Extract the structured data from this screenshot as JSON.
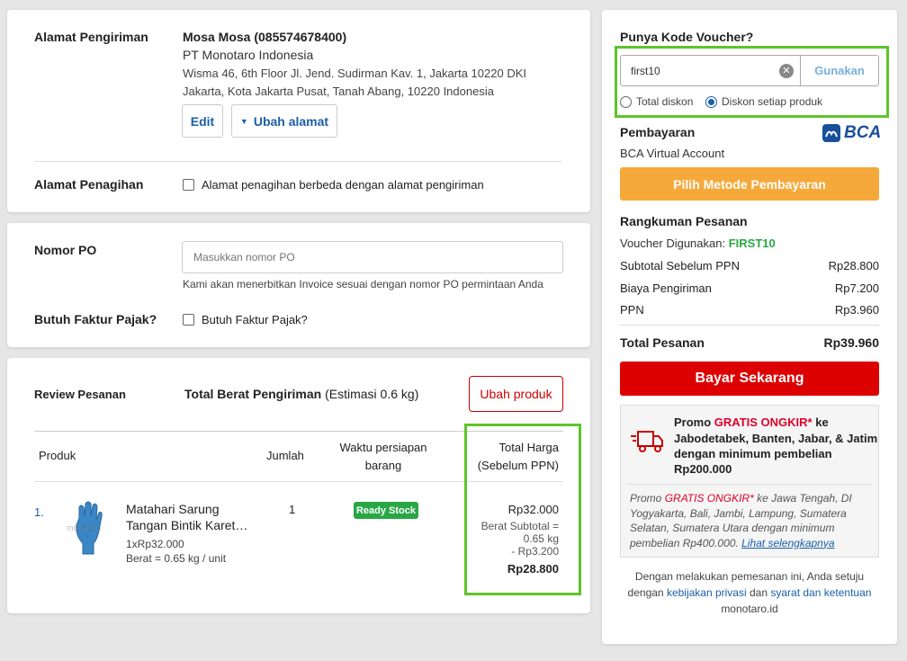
{
  "shipping": {
    "label": "Alamat Pengiriman",
    "name": "Mosa Mosa (085574678400)",
    "company": "PT Monotaro Indonesia",
    "address_line1": "Wisma 46, 6th Floor Jl. Jend. Sudirman Kav. 1, Jakarta 10220 DKI",
    "address_line2": "Jakarta, Kota Jakarta Pusat, Tanah Abang, 10220 Indonesia",
    "edit_label": "Edit",
    "change_label": "Ubah alamat"
  },
  "billing": {
    "label": "Alamat Penagihan",
    "checkbox_label": "Alamat penagihan berbeda dengan alamat pengiriman"
  },
  "po": {
    "label": "Nomor PO",
    "placeholder": "Masukkan nomor PO",
    "hint": "Kami akan menerbitkan Invoice sesuai dengan nomor PO permintaan Anda",
    "tax_label": "Butuh Faktur Pajak?",
    "tax_checkbox_label": "Butuh Faktur Pajak?"
  },
  "review": {
    "label": "Review Pesanan",
    "weight_label": "Total Berat Pengiriman",
    "weight_value": "(Estimasi 0.6 kg)",
    "change_button": "Ubah produk",
    "columns": {
      "product": "Produk",
      "qty": "Jumlah",
      "prep_line1": "Waktu persiapan",
      "prep_line2": "barang",
      "total_line1": "Total Harga",
      "total_line2": "(Sebelum PPN)"
    },
    "items": [
      {
        "index": "1.",
        "name_line1": "Matahari Sarung",
        "name_line2": "Tangan Bintik Karet…",
        "unit_price": "1xRp32.000",
        "weight": "Berat = 0.65 kg / unit",
        "qty": "1",
        "stock": "Ready Stock",
        "price": "Rp32.000",
        "weight_sub_line1": "Berat Subtotal =",
        "weight_sub_line2": "0.65 kg",
        "weight_discount": "- Rp3.200",
        "final_price": "Rp28.800",
        "image_watermark": "monotaro"
      }
    ]
  },
  "voucher": {
    "label": "Punya Kode Voucher?",
    "value": "first10",
    "apply_label": "Gunakan",
    "option_total": "Total diskon",
    "option_each": "Diskon setiap produk"
  },
  "payment": {
    "label": "Pembayaran",
    "method": "BCA Virtual Account",
    "bank_logo": "BCA",
    "choose_label": "Pilih Metode Pembayaran"
  },
  "summary": {
    "label": "Rangkuman Pesanan",
    "voucher_used_label": "Voucher Digunakan:",
    "voucher_used_code": "FIRST10",
    "rows": [
      {
        "label": "Subtotal Sebelum PPN",
        "value": "Rp28.800"
      },
      {
        "label": "Biaya Pengiriman",
        "value": "Rp7.200"
      },
      {
        "label": "PPN",
        "value": "Rp3.960"
      }
    ],
    "total_label": "Total Pesanan",
    "total_value": "Rp39.960",
    "pay_label": "Bayar Sekarang"
  },
  "promo": {
    "main_prefix": "Promo ",
    "main_highlight": "GRATIS ONGKIR*",
    "main_line1_suffix": " ke",
    "main_line2": "Jabodetabek, Banten, Jabar, & Jatim",
    "main_line3": "dengan minimum pembelian",
    "main_line4": "Rp200.000",
    "sub_prefix": "Promo ",
    "sub_highlight": "GRATIS ONGKIR*",
    "sub_line1_suffix": " ke Jawa Tengah, DI",
    "sub_line2": "Yogyakarta, Bali, Jambi, Lampung, Sumatera",
    "sub_line3": "Selatan, Sumatera Utara dengan minimum",
    "sub_line4": "pembelian Rp400.000.",
    "sub_link": "Lihat selengkapnya"
  },
  "terms": {
    "line1": "Dengan melakukan pemesanan ini, Anda setuju",
    "line2_prefix": "dengan",
    "privacy_link": "kebijakan privasi",
    "and": "dan",
    "terms_link": "syarat dan ketentuan",
    "line3": "monotaro.id"
  },
  "colors": {
    "accent_blue": "#1a5fa8",
    "orange": "#f6a93b",
    "pay_red": "#dd0000",
    "ready_green": "#28a745",
    "highlight_green": "#5ec42a"
  }
}
